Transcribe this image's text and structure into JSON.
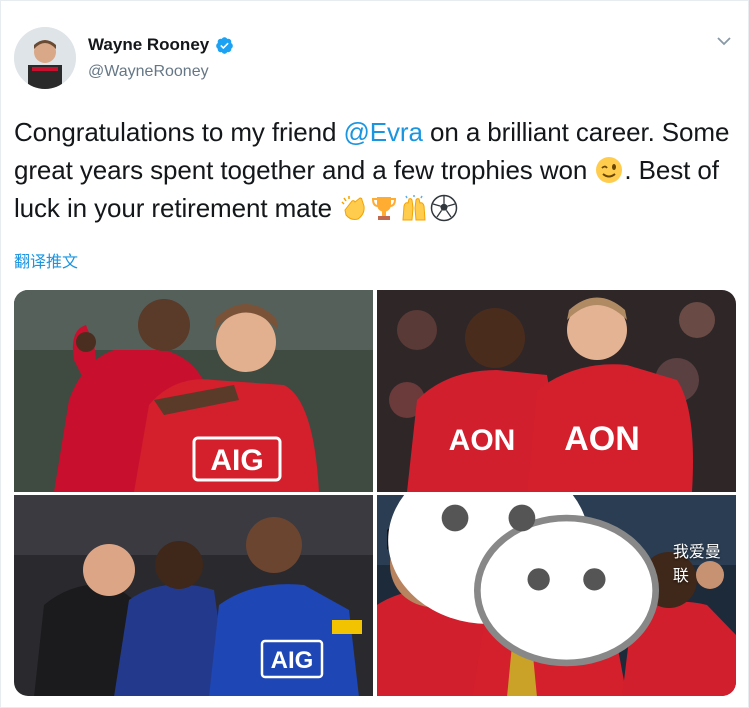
{
  "tweet": {
    "author": {
      "name": "Wayne Rooney",
      "handle": "@WayneRooney",
      "verified": true
    },
    "text": {
      "part1": "Congratulations to my friend ",
      "mention": "@Evra",
      "part2": " on a brilliant career. Some great years spent together and a few trophies won ",
      "part3": ". Best of luck in your retirement mate "
    },
    "emojis": [
      "winking-face",
      "clapping-hands",
      "trophy",
      "raising-hands",
      "soccer-ball"
    ],
    "translate_label": "翻译推文"
  },
  "media": {
    "photos": [
      {
        "id": "evra-rooney-celebration",
        "shirt_text": "AIG"
      },
      {
        "id": "evra-rooney-embrace",
        "shirt_text": "AON"
      },
      {
        "id": "rooney-evra-ferdinand-blue-kit",
        "shirt_text": "AIG"
      },
      {
        "id": "tevez-rooney-evra-trophy"
      }
    ],
    "watermark": "我爱曼联"
  },
  "colors": {
    "accent": "#1b95e0",
    "text": "#14171a",
    "secondary": "#657786",
    "united_red": "#c8102e"
  }
}
